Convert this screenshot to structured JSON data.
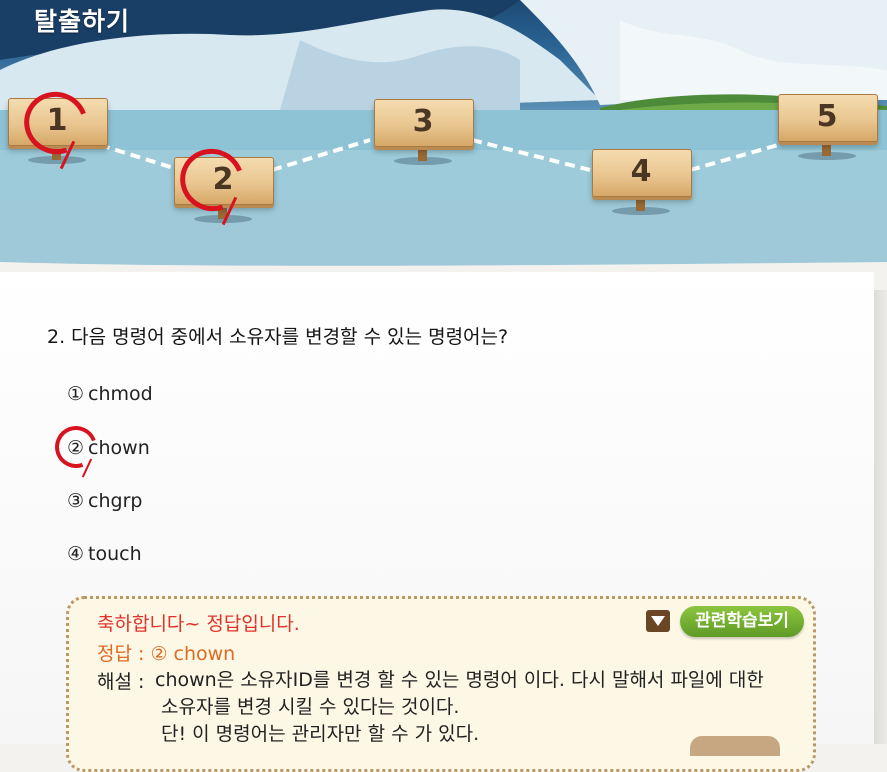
{
  "header": {
    "title": "탈출하기"
  },
  "stages": [
    {
      "label": "1",
      "state": "answered"
    },
    {
      "label": "2",
      "state": "answered"
    },
    {
      "label": "3",
      "state": "locked"
    },
    {
      "label": "4",
      "state": "locked"
    },
    {
      "label": "5",
      "state": "locked"
    }
  ],
  "question": {
    "text": "2. 다음 명령어 중에서 소유자를 변경할 수 있는 명령어는?",
    "options": [
      {
        "mark": "①",
        "text": "chmod"
      },
      {
        "mark": "②",
        "text": "chown",
        "selected": true
      },
      {
        "mark": "③",
        "text": "chgrp"
      },
      {
        "mark": "④",
        "text": "touch"
      }
    ]
  },
  "result": {
    "congrats": "축하합니다~ 정답입니다.",
    "answer": "정답 : ② chown",
    "explain_label": "해설 :",
    "explain_lines": [
      "chown은 소유자ID를 변경 할 수 있는 명령어 이다. 다시 말해서 파일에 대한",
      "소유자를 변경 시킬 수 있다는 것이다.",
      "단! 이 명령어는 관리자만 할 수 가 있다."
    ],
    "related_button": "관련학습보기"
  },
  "colors": {
    "mark_red": "#d8121f",
    "congrats_red": "#e0322a",
    "answer_orange": "#e06a22",
    "related_green": "#6fae2e"
  }
}
